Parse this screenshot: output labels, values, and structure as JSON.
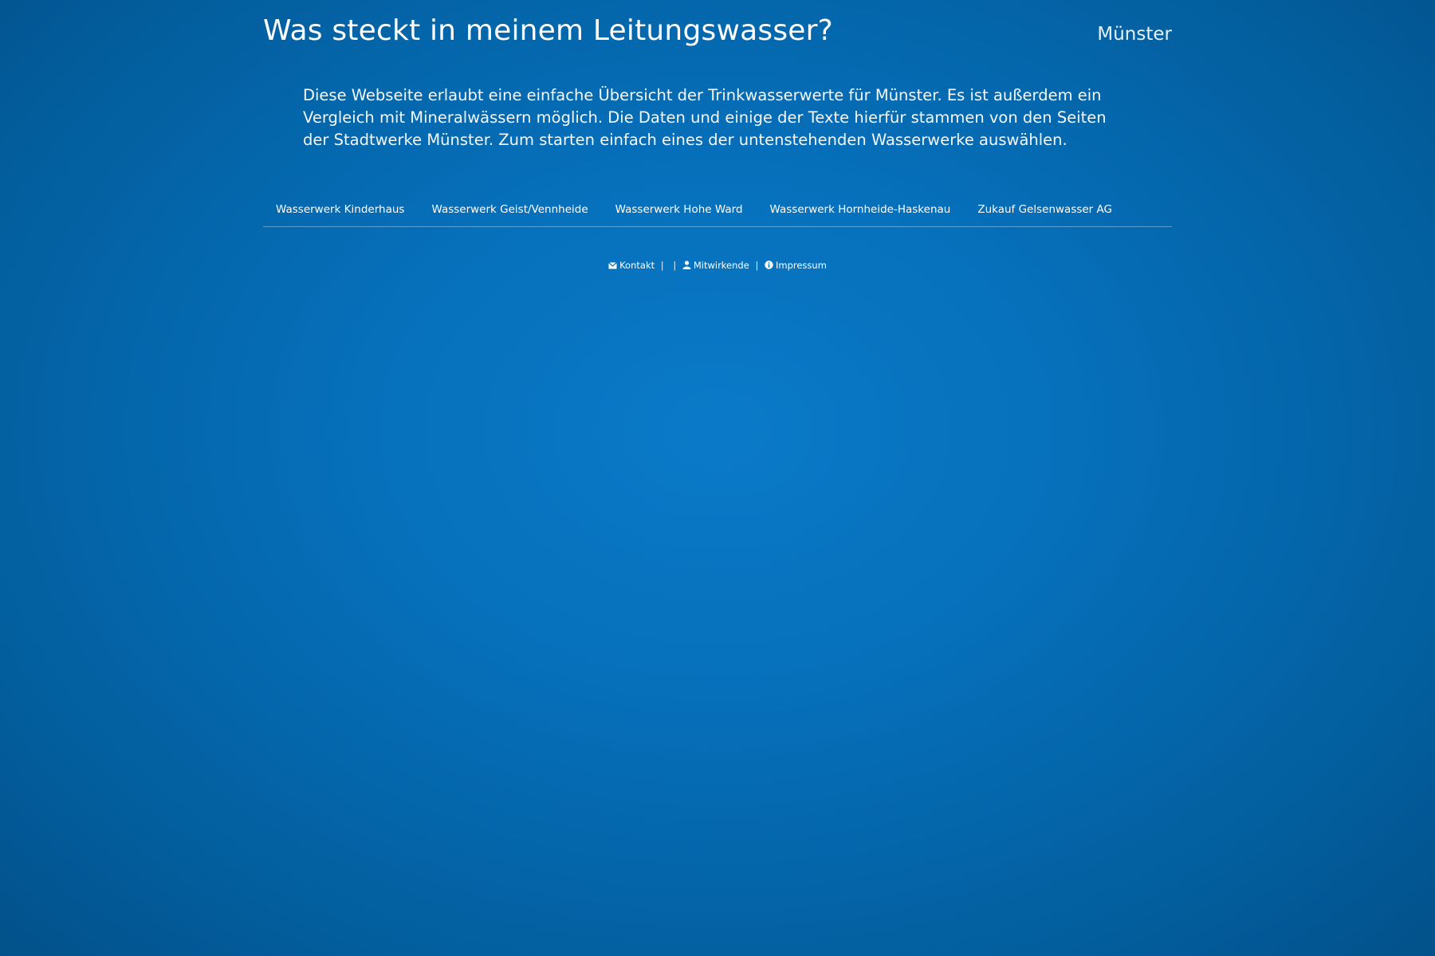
{
  "header": {
    "title": "Was steckt in meinem Leitungswasser?",
    "city": "Münster"
  },
  "intro": {
    "text": "Diese Webseite erlaubt eine einfache Übersicht der Trinkwasserwerte für Münster. Es ist außerdem ein Vergleich mit Mineralwässern möglich. Die Daten und einige der Texte hierfür stammen von den Seiten der Stadtwerke Münster. Zum starten einfach eines der untenstehenden Wasserwerke auswählen."
  },
  "tabs": [
    {
      "label": "Wasserwerk Kinderhaus"
    },
    {
      "label": "Wasserwerk Geist/Vennheide"
    },
    {
      "label": "Wasserwerk Hohe Ward"
    },
    {
      "label": "Wasserwerk Hornheide-Haskenau"
    },
    {
      "label": "Zukauf Gelsenwasser AG"
    }
  ],
  "footer": {
    "kontakt": {
      "label": "Kontakt",
      "icon": "envelope-icon"
    },
    "mitwirkende": {
      "label": "Mitwirkende",
      "icon": "user-icon"
    },
    "impressum": {
      "label": "Impressum",
      "icon": "info-circle-icon"
    },
    "separator": "|"
  },
  "colors": {
    "background_center": "#0a7ac8",
    "background_edge": "#02518a",
    "text": "#ffffff"
  }
}
